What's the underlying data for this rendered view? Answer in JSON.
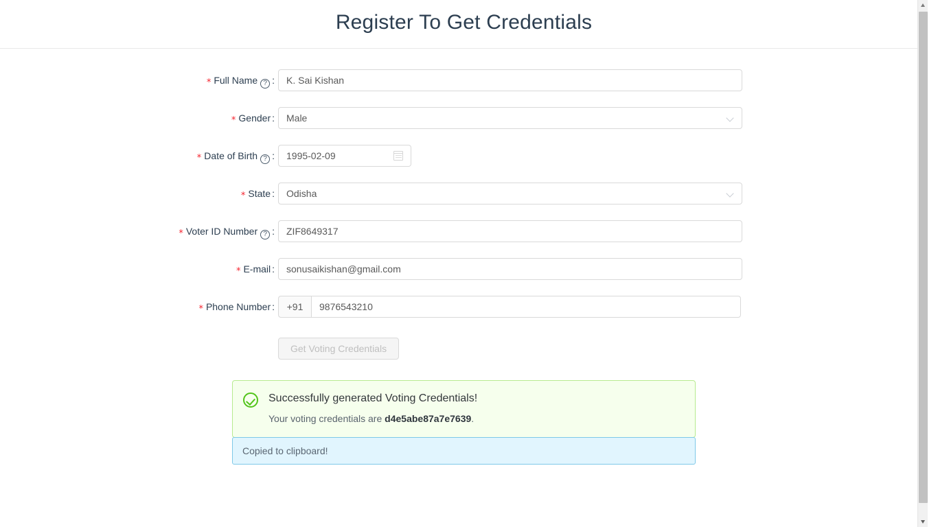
{
  "header": {
    "title": "Register To Get Credentials"
  },
  "form": {
    "required_marker": "*",
    "help_icon_glyph": "?",
    "colon": ":",
    "fields": [
      {
        "id": "full-name",
        "label": "Full Name",
        "value": "K. Sai Kishan",
        "required": true,
        "has_help_icon": true,
        "type": "text"
      },
      {
        "id": "gender",
        "label": "Gender",
        "value": "Male",
        "required": true,
        "has_help_icon": false,
        "type": "select",
        "icon": "chevron-down-icon"
      },
      {
        "id": "date-of-birth",
        "label": "Date of Birth",
        "value": "1995-02-09",
        "required": true,
        "has_help_icon": true,
        "type": "date",
        "icon": "calendar-icon"
      },
      {
        "id": "state",
        "label": "State",
        "value": "Odisha",
        "required": true,
        "has_help_icon": false,
        "type": "select",
        "icon": "chevron-down-icon"
      },
      {
        "id": "voter-id-number",
        "label": "Voter ID Number",
        "value": "ZIF8649317",
        "required": true,
        "has_help_icon": true,
        "type": "text"
      },
      {
        "id": "email",
        "label": "E-mail",
        "value": "sonusaikishan@gmail.com",
        "required": true,
        "has_help_icon": false,
        "type": "text"
      }
    ],
    "phone": {
      "id": "phone-number",
      "label": "Phone Number",
      "required": true,
      "prefix": "+91",
      "value": "9876543210"
    },
    "submit": {
      "label": "Get Voting Credentials",
      "disabled": true
    }
  },
  "alerts": {
    "success": {
      "icon": "check-circle-icon",
      "title": "Successfully generated Voting Credentials!",
      "desc_prefix": "Your voting credentials are ",
      "credential": "d4e5abe87a7e7639",
      "desc_suffix": "."
    },
    "info": {
      "message": "Copied to clipboard!"
    }
  },
  "colors": {
    "required_star": "#f5222d",
    "title_text": "#2c3e50",
    "success_bg": "#f6ffed",
    "success_border": "#b7eb8f",
    "success_icon": "#52c41a",
    "info_bg": "#e1f5fe",
    "info_border": "#7ec8e8",
    "input_border": "#d9d9d9"
  }
}
